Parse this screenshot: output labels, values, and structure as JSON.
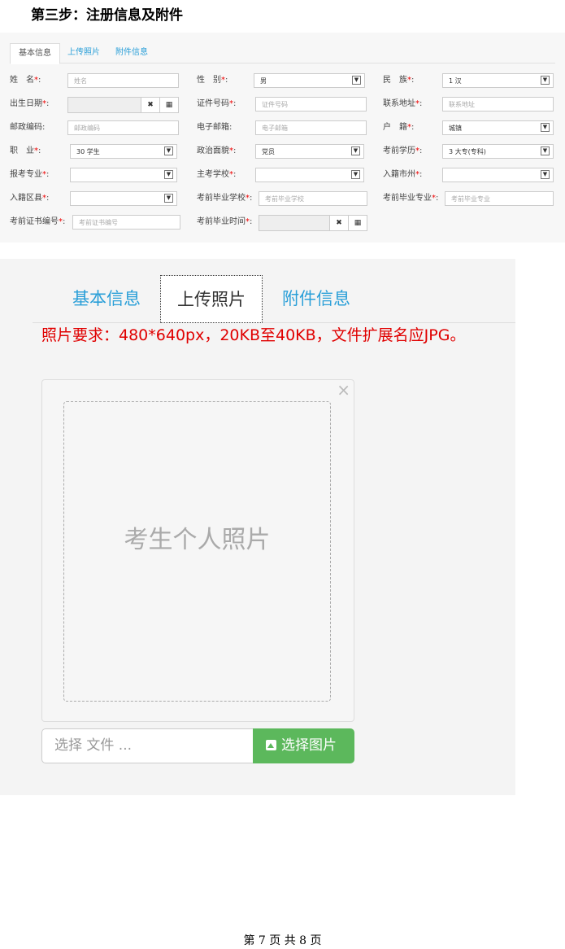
{
  "heading": "第三步：注册信息及附件",
  "form": {
    "tabs": [
      "基本信息",
      "上传照片",
      "附件信息"
    ],
    "name": {
      "label": "姓　名",
      "placeholder": "姓名"
    },
    "gender": {
      "label": "性　别",
      "value": "男"
    },
    "ethnicity": {
      "label": "民　族",
      "value": "1 汉"
    },
    "birth_date": {
      "label": "出生日期"
    },
    "id_number": {
      "label": "证件号码",
      "placeholder": "证件号码"
    },
    "address": {
      "label": "联系地址",
      "placeholder": "联系地址"
    },
    "postcode": {
      "label": "邮政编码:",
      "placeholder": "邮政编码"
    },
    "email": {
      "label": "电子邮箱:",
      "placeholder": "电子邮箱"
    },
    "household": {
      "label": "户　籍",
      "value": "城镇"
    },
    "occupation": {
      "label": "职　业",
      "value": "30 学生"
    },
    "political": {
      "label": "政治面貌",
      "value": "党员"
    },
    "education": {
      "label": "考前学历",
      "value": "3 大专(专科)"
    },
    "major": {
      "label": "报考专业",
      "value": ""
    },
    "school": {
      "label": "主考学校",
      "value": ""
    },
    "city": {
      "label": "入籍市州",
      "value": ""
    },
    "district": {
      "label": "入籍区县",
      "value": ""
    },
    "grad_school": {
      "label": "考前毕业学校",
      "placeholder": "考前毕业学校"
    },
    "grad_major": {
      "label": "考前毕业专业",
      "placeholder": "考前毕业专业"
    },
    "cert_no": {
      "label": "考前证书编号",
      "placeholder": "考前证书编号"
    },
    "grad_time": {
      "label": "考前毕业时间"
    },
    "required_mark": "*",
    "colon": ":"
  },
  "upload": {
    "tabs": [
      "基本信息",
      "上传照片",
      "附件信息"
    ],
    "requirement": "照片要求：480*640px，20KB至40KB，文件扩展名应JPG。",
    "close_symbol": "×",
    "photo_placeholder": "考生个人照片",
    "file_placeholder": "选择 文件 ...",
    "pick_button": "选择图片"
  },
  "footer": "第 7 页 共 8 页",
  "colors": {
    "accent": "#2a9fd8",
    "required": "#e00000",
    "success": "#5cb85c"
  }
}
